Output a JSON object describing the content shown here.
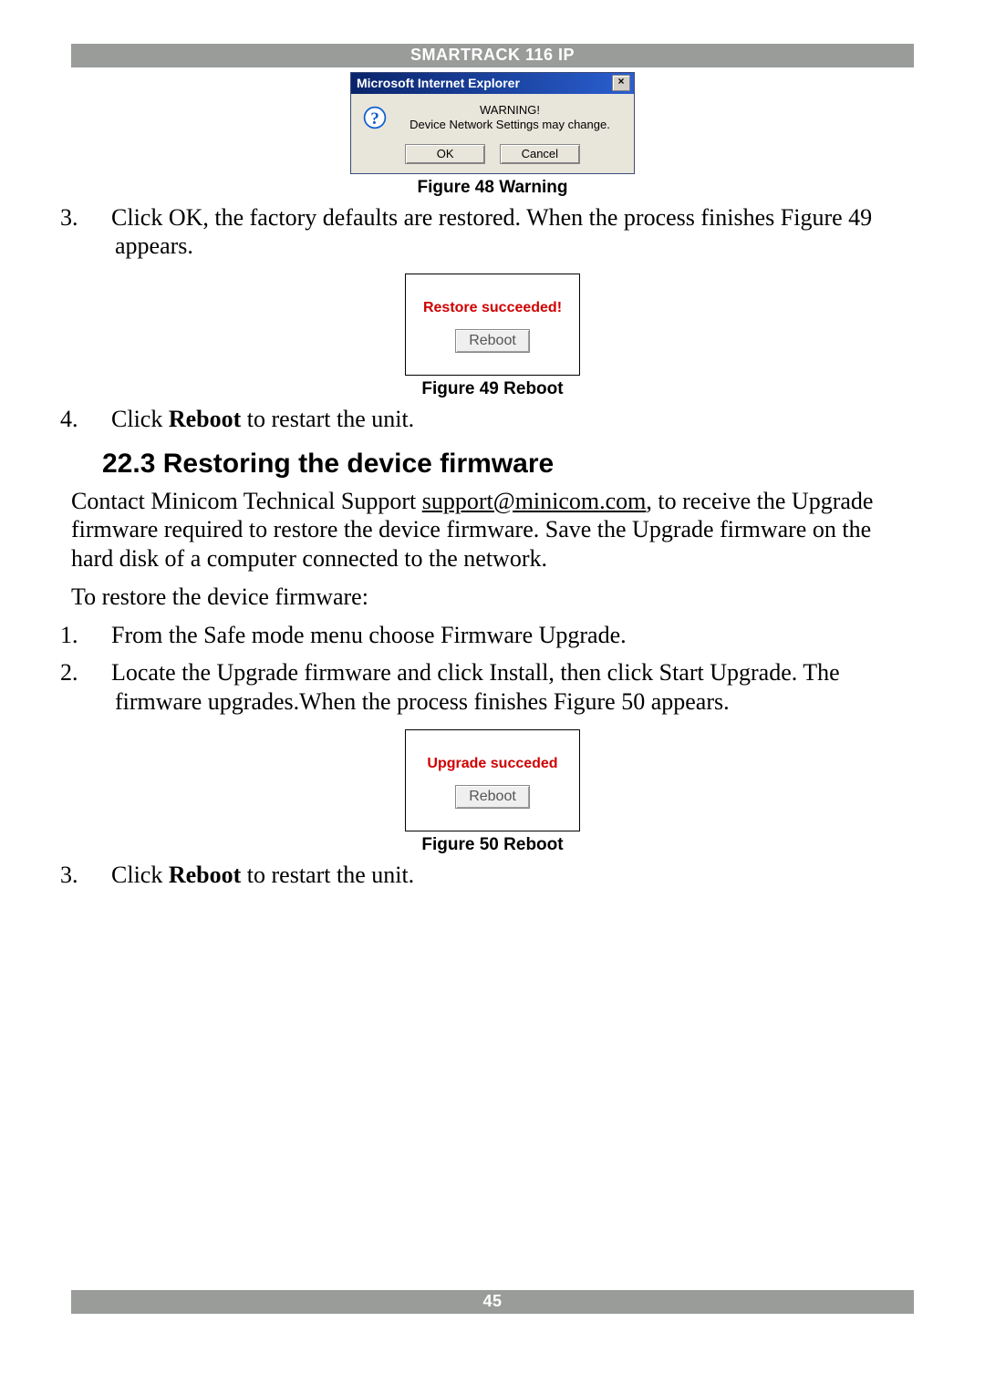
{
  "header": {
    "title": "SMARTRACK 116 IP"
  },
  "footer": {
    "page": "45"
  },
  "fig48": {
    "titlebar": "Microsoft Internet Explorer",
    "line1": "WARNING!",
    "line2": "Device Network Settings may change.",
    "ok": "OK",
    "cancel": "Cancel",
    "caption": "Figure 48 Warning"
  },
  "step3": {
    "num": "3.",
    "text": "Click OK, the factory defaults are restored. When the process finishes Figure 49 appears."
  },
  "fig49": {
    "msg": "Restore succeeded!",
    "btn": "Reboot",
    "caption": "Figure 49 Reboot"
  },
  "step4": {
    "num": "4.",
    "pre": "Click ",
    "bold": "Reboot",
    "post": " to restart the unit."
  },
  "section": {
    "num": "22.3",
    "title": "Restoring the device firmware"
  },
  "para1": {
    "a": "Contact Minicom Technical Support ",
    "email": "support@minicom.com",
    "b": ", to receive the Upgrade firmware required to restore the device firmware. Save the Upgrade firmware on the hard disk of a computer connected to the network."
  },
  "para2": "To restore the device firmware:",
  "list": {
    "i1": {
      "num": "1.",
      "text": "From the Safe mode menu choose Firmware Upgrade."
    },
    "i2": {
      "num": "2.",
      "text": "Locate the Upgrade firmware and click Install, then click Start Upgrade. The firmware upgrades.When the process finishes Figure 50 appears."
    },
    "i3": {
      "num": "3.",
      "pre": "Click ",
      "bold": "Reboot",
      "post": " to restart the unit."
    }
  },
  "fig50": {
    "msg": "Upgrade succeded",
    "btn": "Reboot",
    "caption": "Figure 50 Reboot"
  }
}
